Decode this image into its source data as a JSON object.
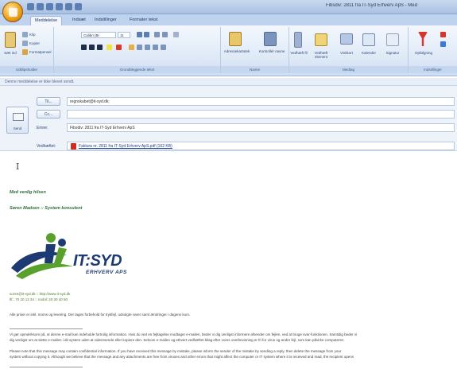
{
  "window": {
    "title": "Fibsdiv: 2811 fra IT-Syd Erhverv ApS - Med"
  },
  "tabs": [
    "Meddelelse",
    "Indsæt",
    "Indstillinger",
    "Formater tekst"
  ],
  "ribbon": {
    "clipboard": {
      "paste": "Sæt ind",
      "cut": "Klip",
      "copy": "Kopier",
      "format_painter": "Formatpensel",
      "label": "Udklipsholder"
    },
    "font": {
      "name": "Calibri (Br",
      "size": "11",
      "label": "Grundlæggende tekst"
    },
    "names": {
      "address_book": "Adressekartotek",
      "check_names": "Kontrollér navne",
      "label": "Navne"
    },
    "include": {
      "attach_file": "Vedhæft fil",
      "attach_item": "Vedhæft element",
      "business_card": "Visitkort",
      "calendar": "Kalender",
      "signature": "Signatur",
      "label": "Medtag"
    },
    "options": {
      "follow_up": "Opfølgning",
      "label": "Indstillinger"
    }
  },
  "infobar": {
    "text": "Denne meddelelse er ikke blevet sendt."
  },
  "header": {
    "send": "Send",
    "to_button": "Til...",
    "to_value": "regnskabet@it-syd.dk;",
    "cc_button": "Cc...",
    "cc_value": "",
    "subject_label": "Emne:",
    "subject_value": "Fibsdiv: 2811 fra IT-Syd Erhverv ApS",
    "attach_label": "Vedhæftet:",
    "attach_value": "Faktura nr. 2811 fra IT-Syd Erhverv ApS.pdf (162 KB)"
  },
  "body": {
    "cursor": "I",
    "greeting": "Med venlig hilsen",
    "signature": "Søren Madsen :: System konsulent",
    "logo_main": "IT:SYD",
    "logo_sub": "ERHVERV APS",
    "contact_1": "soren@it-syd.dk :: http://www.it-syd.dk",
    "contact_2": "tlf.: 70 20 12 34 :: mobil: 20 30 40 50",
    "note": "Alle priser er inkl. moms og levering. Der tages forbehold for trykfejl, udsolgte varer samt ændringer i dagens kurs.",
    "disclaimer_da_1": "Vi gør opmærksom på, at denne e-mail kan indeholde fortrolig information. Hvis du ved en fejltagelse modtager e-mailen, beder vi dig venligst informere afsender om fejlen, ved at bruge svar-funktionen. Samtidig beder vi",
    "disclaimer_da_2": "dig venligst om at slette e-mailen i dit system uden at videresende eller kopiere den. Selvom e-mailen og ethvert vedhæftet bilag efter vores overbevisning er fri for virus og andre fejl, som kan påvirke computeren",
    "disclaimer_en_1": "Please note that this message may contain confidential information. If you have received this message by mistake, please inform the sender of the mistake by sending a reply, then delete the message from your",
    "disclaimer_en_2": "system without copying it. Although we believe that the message and any attachments are free from viruses and other errors that might affect the computer or IT system where it is received and read, the recipient opens"
  },
  "colors": {
    "accent": "#1d3b72",
    "logo_green": "#5aa02c",
    "signature_green": "#2d6f3a"
  }
}
